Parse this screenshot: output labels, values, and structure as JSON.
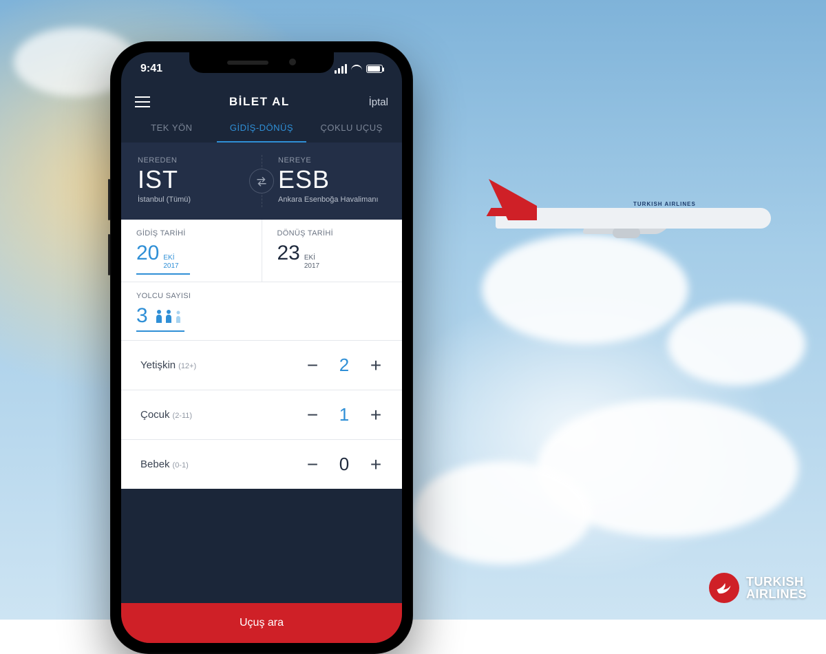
{
  "statusbar": {
    "time": "9:41"
  },
  "header": {
    "title": "BİLET AL",
    "cancel": "İptal"
  },
  "tabs": {
    "one_way": "TEK YÖN",
    "round_trip": "GİDİŞ-DÖNÜŞ",
    "multi": "ÇOKLU UÇUŞ"
  },
  "route": {
    "from_label": "NEREDEN",
    "from_code": "IST",
    "from_city": "İstanbul (Tümü)",
    "to_label": "NEREYE",
    "to_code": "ESB",
    "to_city": "Ankara Esenboğa Havalimanı"
  },
  "dates": {
    "depart_label": "GİDİŞ TARİHİ",
    "depart_day": "20",
    "depart_month": "EKİ",
    "depart_year": "2017",
    "return_label": "DÖNÜŞ TARİHİ",
    "return_day": "23",
    "return_month": "EKİ",
    "return_year": "2017"
  },
  "pax": {
    "label": "YOLCU SAYISI",
    "total": "3",
    "rows": [
      {
        "type": "Yetişkin",
        "age": "(12+)",
        "count": "2"
      },
      {
        "type": "Çocuk",
        "age": "(2-11)",
        "count": "1"
      },
      {
        "type": "Bebek",
        "age": "(0-1)",
        "count": "0"
      }
    ]
  },
  "cta": "Uçuş ara",
  "brand": {
    "line1": "TURKISH",
    "line2": "AIRLINES"
  },
  "plane_livery": "TURKISH AIRLINES"
}
